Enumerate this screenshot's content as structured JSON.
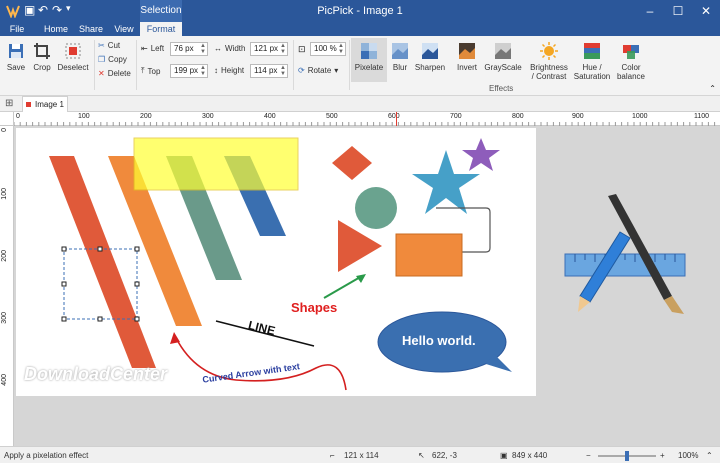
{
  "window": {
    "title": "PicPick - Image 1",
    "context_tab": "Selection"
  },
  "tabs": [
    "File",
    "Home",
    "Share",
    "View",
    "Format"
  ],
  "ribbon": {
    "save": "Save",
    "crop": "Crop",
    "deselect": "Deselect",
    "cut": "Cut",
    "copy": "Copy",
    "delete": "Delete",
    "left_label": "Left",
    "left_value": "76 px",
    "top_label": "Top",
    "top_value": "199 px",
    "width_label": "Width",
    "width_value": "121 px",
    "height_label": "Height",
    "height_value": "114 px",
    "zoom_value": "100 %",
    "rotate": "Rotate",
    "effects": [
      "Pixelate",
      "Blur",
      "Sharpen",
      "Invert",
      "GrayScale",
      "Brightness / Contrast",
      "Hue / Saturation",
      "Color balance"
    ],
    "effects_group_label": "Effects"
  },
  "document_tab": "Image 1",
  "ruler_h": [
    "0",
    "100",
    "200",
    "300",
    "400",
    "500",
    "600",
    "700",
    "800",
    "900",
    "1000",
    "1100"
  ],
  "ruler_v": [
    "0",
    "100",
    "200",
    "300",
    "400"
  ],
  "canvas": {
    "shapes_label": "Shapes",
    "line_label": "LINE",
    "hello": "Hello world.",
    "curved_text": "Curved Arrow with text",
    "watermark": "DownloadCenter"
  },
  "status": {
    "message": "Apply a pixelation effect",
    "selection_size": "121 x 114",
    "cursor_pos": "622, -3",
    "image_size": "849 x 440",
    "zoom": "100%"
  }
}
